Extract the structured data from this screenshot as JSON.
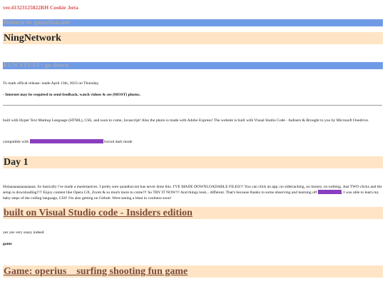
{
  "version": "ver.41323125822RH Cookie .beta",
  "nav": {
    "return_link": "Return to quanthai.net"
  },
  "site_title": "NingNetwork",
  "fun_stuff": {
    "heading": "FUN STUFF: go down"
  },
  "release_note": "To mark offical release: made April 13th, 2023 on Thursday.",
  "internet_note": "- Internet may be required to send feedback, watch videos & see (MOST) photos.",
  "built_with": "built with Hyper Text Markup Language (HTML), CSS, and soon to come, Javascript! Also the photo is made with Adobe Express! The website is built with Visual Studio Code - Indisers & Brought to you by Microsoft Onedrive.",
  "compat": {
    "prefix": "compatible with",
    "suffix": "forced dark mode"
  },
  "day1": {
    "heading": "Day 1",
    "text_before": "Holaaaaaaaaaaaaaaa. So basically i've made a masterpeices. I pretty sure quanthai.net has never done this. I'VE MADE DOWNLOADABLE FILES!!! You can click an app, no sidetracking, no money, no nothing. Just TWO clicks and the setup is downloading!!!! Enjoy content like Opera GX, Zoom & so much more to come!!! So TRY IT NOW!!! And things look... different. That's because thanks to some observing and learning off",
    "text_after": ", I was able to learn my baby steps of the coding language, CSS! I'm also getting on Github. Were seeing a blast in coolness soon!"
  },
  "vs_section": {
    "heading": "built on Visual Studio code - Insiders edition",
    "text": "yes yes very sussy indeed"
  },
  "game_label": "game",
  "game_section": {
    "heading": "Game: operius _ surfing shooting fun game"
  },
  "colors": {
    "version_red": "#d9534f",
    "nav_blue": "#6f9ae6",
    "heading_peach": "#ffe5c6",
    "highlight_purple": "#8a3fbf",
    "link_brown": "#7a4a3a"
  }
}
